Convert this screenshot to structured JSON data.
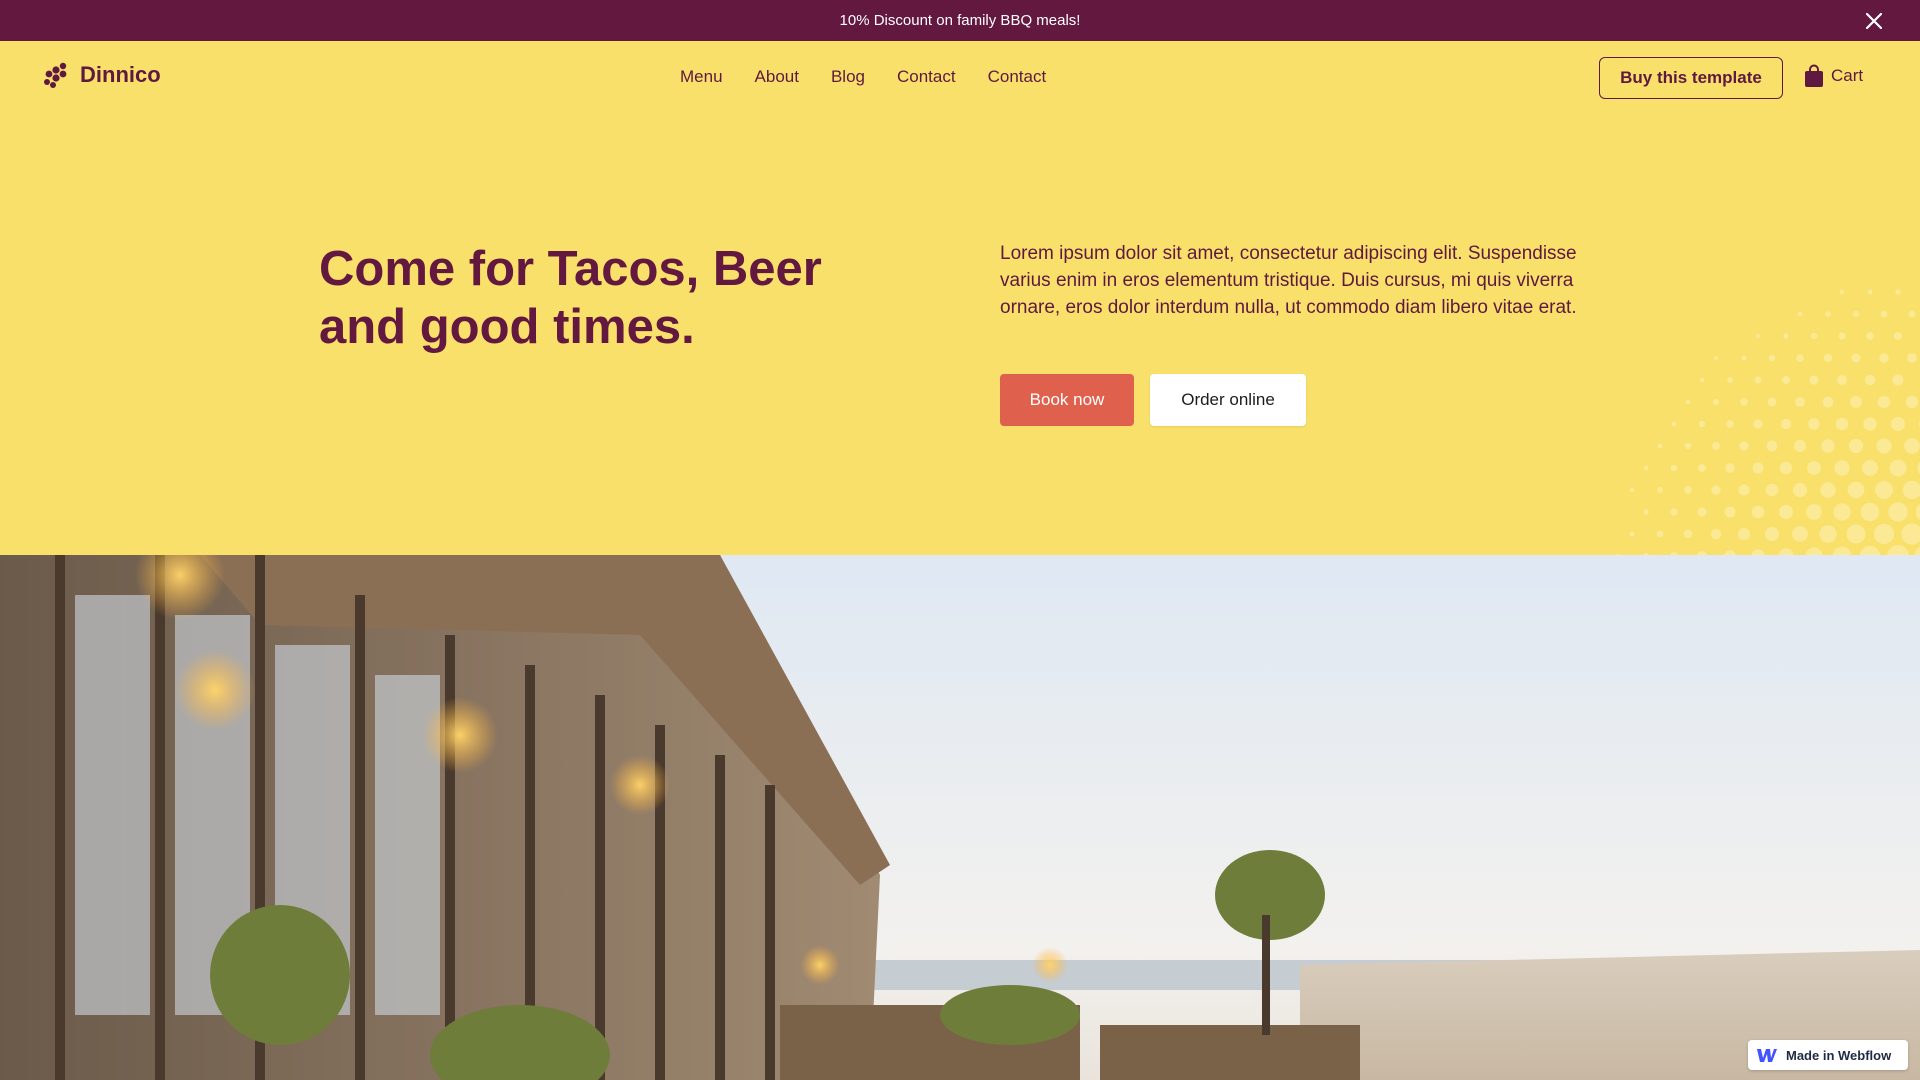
{
  "announcement": {
    "text": "10% Discount on family BBQ meals!",
    "close_icon": "close-icon"
  },
  "nav": {
    "brand": "Dinnico",
    "logo_icon": "grape-cluster-icon",
    "links": [
      "Menu",
      "About",
      "Blog",
      "Contact",
      "Contact"
    ],
    "buy_label": "Buy this template",
    "cart_label": "Cart",
    "cart_icon": "shopping-bag-icon"
  },
  "hero": {
    "title": "Come for Tacos, Beer and good times.",
    "description": "Lorem ipsum dolor sit amet, consectetur adipiscing elit. Suspendisse varius enim in eros elementum tristique. Duis cursus, mi quis viverra ornare, eros dolor interdum nulla, ut commodo diam libero vitae erat.",
    "book_label": "Book now",
    "order_label": "Order online"
  },
  "badge": {
    "label": "Made in Webflow",
    "icon": "webflow-icon"
  },
  "colors": {
    "announcement_bg": "#62183f",
    "page_bg": "#f8e06b",
    "brand_text": "#5f1940",
    "book_button_bg": "#e0604e",
    "order_button_bg": "#ffffff"
  }
}
